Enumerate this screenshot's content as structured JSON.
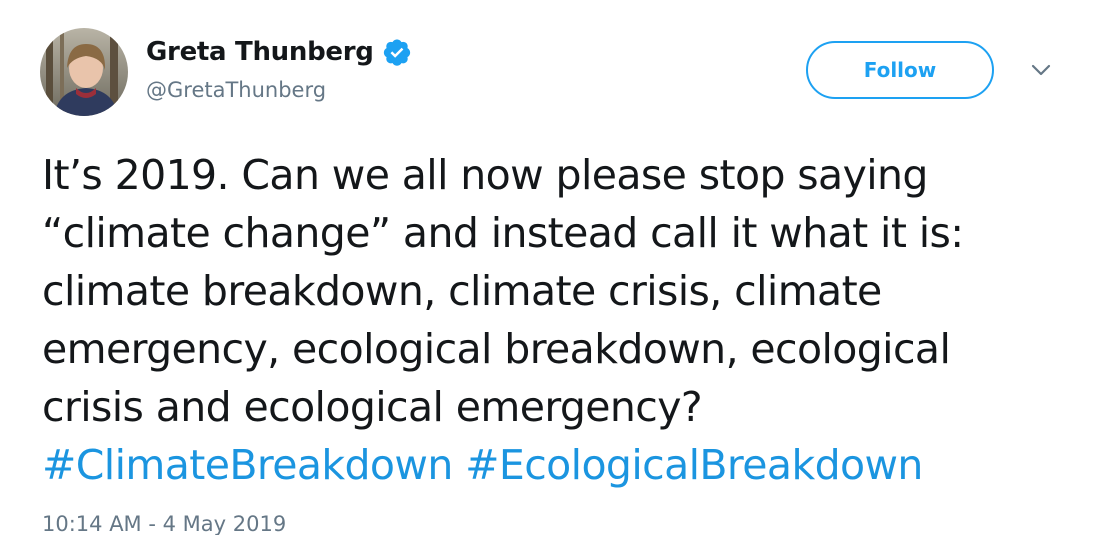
{
  "author": {
    "display_name": "Greta Thunberg",
    "handle": "@GretaThunberg",
    "verified": true
  },
  "actions": {
    "follow_label": "Follow",
    "more_icon": "chevron-down-icon"
  },
  "tweet": {
    "lines": [
      "It’s 2019. Can we all now please stop saying",
      "“climate change” and instead call it what it is:",
      "climate breakdown, climate crisis, climate",
      "emergency, ecological breakdown, ecological",
      "crisis and ecological emergency?"
    ],
    "hashtags": [
      "#ClimateBreakdown",
      "#EcologicalBreakdown"
    ],
    "timestamp": "10:14 AM - 4 May 2019"
  },
  "colors": {
    "brand_blue": "#1da1f2",
    "hashtag_blue": "#1b95e0",
    "text_dark": "#14171a",
    "text_muted": "#657786"
  }
}
